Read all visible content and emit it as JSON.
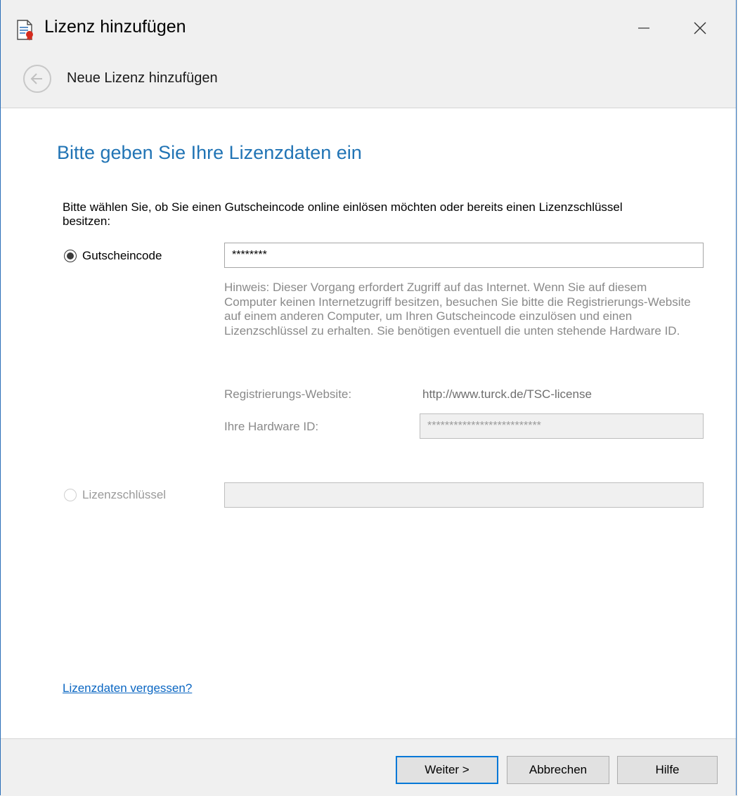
{
  "window": {
    "title": "Lizenz hinzufügen"
  },
  "wizard_header": {
    "title": "Neue Lizenz hinzufügen"
  },
  "content": {
    "heading": "Bitte geben Sie Ihre Lizenzdaten ein",
    "instruction": "Bitte wählen Sie, ob Sie einen Gutscheincode online einlösen möchten oder bereits einen Lizenzschlüssel besitzen:",
    "voucher": {
      "label": "Gutscheincode",
      "selected": true,
      "value": "********"
    },
    "hint": "Hinweis: Dieser Vorgang erfordert Zugriff auf das Internet. Wenn Sie auf diesem Computer keinen Internetzugriff besitzen, besuchen Sie bitte die Registrierungs-Website auf einem anderen Computer, um Ihren Gutscheincode einzulösen und einen Lizenzschlüssel zu erhalten. Sie benötigen eventuell die unten stehende Hardware ID.",
    "registration": {
      "label": "Registrierungs-Website:",
      "url": "http://www.turck.de/TSC-license"
    },
    "hardware_id": {
      "label": "Ihre Hardware ID:",
      "value": "**************************"
    },
    "license_key": {
      "label": "Lizenzschlüssel",
      "selected": false,
      "value": ""
    },
    "forgot_link": "Lizenzdaten vergessen?"
  },
  "footer": {
    "next_label": "Weiter >",
    "cancel_label": "Abbrechen",
    "help_label": "Hilfe"
  },
  "colors": {
    "accent": "#2174b5",
    "link": "#0a66c2",
    "window_border": "#2b6fb8"
  }
}
